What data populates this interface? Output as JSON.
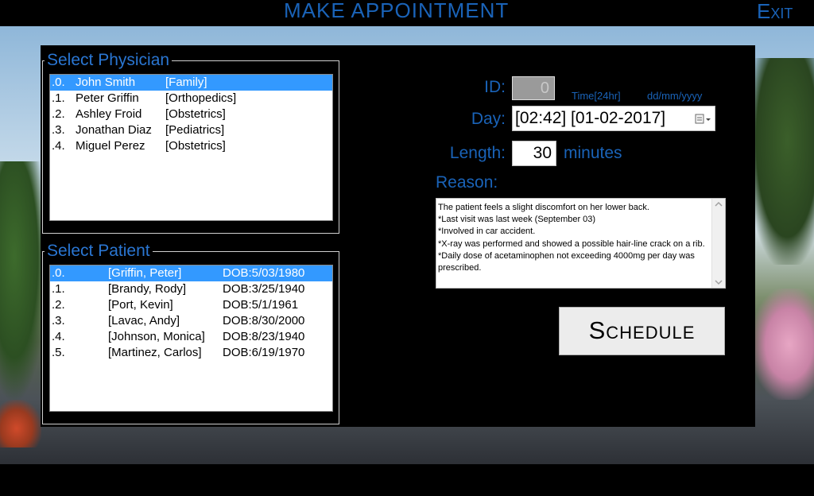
{
  "header": {
    "title": "MAKE APPOINTMENT",
    "exit_label": "Exit"
  },
  "physician_group": {
    "title": "Select Physician",
    "rows": [
      {
        "index": ".0.",
        "name": "John Smith",
        "specialty": "[Family]",
        "selected": true
      },
      {
        "index": ".1.",
        "name": "Peter Griffin",
        "specialty": "[Orthopedics]",
        "selected": false
      },
      {
        "index": ".2.",
        "name": "Ashley Froid",
        "specialty": "[Obstetrics]",
        "selected": false
      },
      {
        "index": ".3.",
        "name": "Jonathan Diaz",
        "specialty": "[Pediatrics]",
        "selected": false
      },
      {
        "index": ".4.",
        "name": "Miguel Perez",
        "specialty": "[Obstetrics]",
        "selected": false
      }
    ]
  },
  "patient_group": {
    "title": "Select Patient",
    "rows": [
      {
        "index": ".0.",
        "name": "[Griffin, Peter]",
        "dob": "DOB:5/03/1980",
        "selected": true
      },
      {
        "index": ".1.",
        "name": "[Brandy, Rody]",
        "dob": "DOB:3/25/1940",
        "selected": false
      },
      {
        "index": ".2.",
        "name": "[Port, Kevin]",
        "dob": "DOB:5/1/1961",
        "selected": false
      },
      {
        "index": ".3.",
        "name": "[Lavac, Andy]",
        "dob": "DOB:8/30/2000",
        "selected": false
      },
      {
        "index": ".4.",
        "name": "[Johnson, Monica]",
        "dob": "DOB:8/23/1940",
        "selected": false
      },
      {
        "index": ".5.",
        "name": "[Martinez, Carlos]",
        "dob": "DOB:6/19/1970",
        "selected": false
      }
    ]
  },
  "form": {
    "id_label": "ID:",
    "id_value": "0",
    "time_hint": "Time[24hr]",
    "date_hint": "dd/mm/yyyy",
    "day_label": "Day:",
    "day_value": "[02:42] [01-02-2017]",
    "length_label": "Length:",
    "length_value": "30",
    "length_unit": "minutes",
    "reason_label": "Reason:",
    "reason_text": "The patient feels a slight discomfort on her lower back.\n*Last visit was last week (September 03)\n*Involved in car accident.\n*X-ray was performed and showed a possible hair-line crack on a rib.\n*Daily dose of acetaminophen not exceeding 4000mg per day was prescribed.",
    "schedule_label": "Schedule"
  },
  "icons": {
    "calendar": "calendar-dropdown-icon"
  },
  "colors": {
    "accent": "#1a63b8",
    "legend": "#2a76d2",
    "selection": "#3399ff"
  }
}
